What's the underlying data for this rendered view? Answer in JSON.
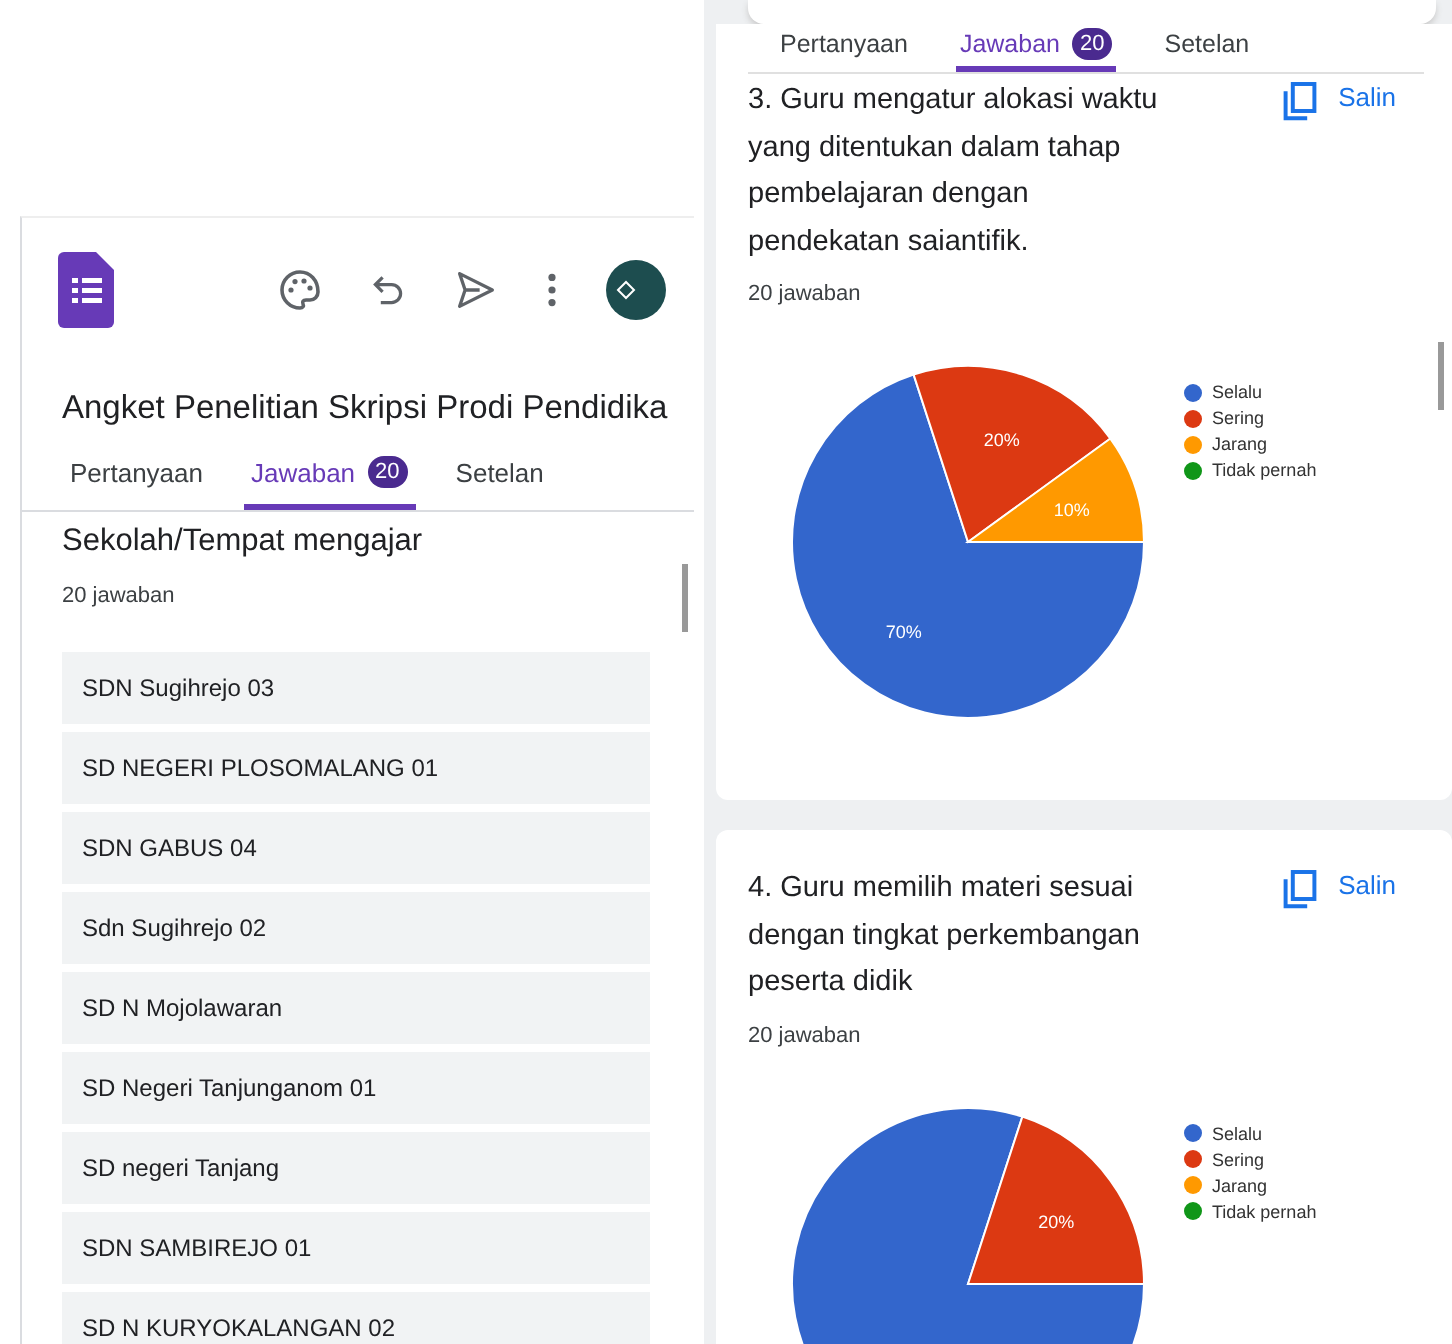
{
  "left": {
    "title": "Angket Penelitian Skripsi Prodi Pendidika",
    "tabs": [
      {
        "label": "Pertanyaan",
        "selected": false
      },
      {
        "label": "Jawaban",
        "badge": "20",
        "selected": true
      },
      {
        "label": "Setelan",
        "selected": false
      }
    ],
    "question": "Sekolah/Tempat mengajar",
    "count": "20 jawaban",
    "answers": [
      "SDN Sugihrejo 03",
      "SD NEGERI PLOSOMALANG 01",
      "SDN GABUS 04",
      "Sdn Sugihrejo 02",
      "SD N Mojolawaran",
      "SD Negeri Tanjunganom 01",
      "SD negeri Tanjang",
      "SDN SAMBIREJO 01",
      "SD N KURYOKALANGAN 02"
    ]
  },
  "right": {
    "tabs": [
      {
        "label": "Pertanyaan",
        "selected": false
      },
      {
        "label": "Jawaban",
        "badge": "20",
        "selected": true
      },
      {
        "label": "Setelan",
        "selected": false
      }
    ],
    "cards": [
      {
        "question": "3. Guru mengatur alokasi waktu yang ditentukan dalam tahap pembelajaran dengan pendekatan saiantifik.",
        "count": "20 jawaban",
        "copy_label": "Salin",
        "chart_data": {
          "type": "pie",
          "legend": "right",
          "categories": [
            "Selalu",
            "Sering",
            "Jarang",
            "Tidak pernah"
          ],
          "values": [
            70,
            20,
            10,
            0
          ],
          "colors": [
            "#3366cc",
            "#dc3912",
            "#ff9900",
            "#109618"
          ],
          "value_labels": [
            "70%",
            "20%",
            "10%",
            null
          ]
        }
      },
      {
        "question": "4. Guru memilih materi sesuai dengan tingkat perkembangan peserta didik",
        "count": "20 jawaban",
        "copy_label": "Salin",
        "chart_data": {
          "type": "pie",
          "legend": "right",
          "categories": [
            "Selalu",
            "Sering",
            "Jarang",
            "Tidak pernah"
          ],
          "values": [
            80,
            20,
            0,
            0
          ],
          "colors": [
            "#3366cc",
            "#dc3912",
            "#ff9900",
            "#109618"
          ],
          "value_labels": [
            null,
            "20%",
            null,
            null
          ]
        }
      }
    ]
  }
}
